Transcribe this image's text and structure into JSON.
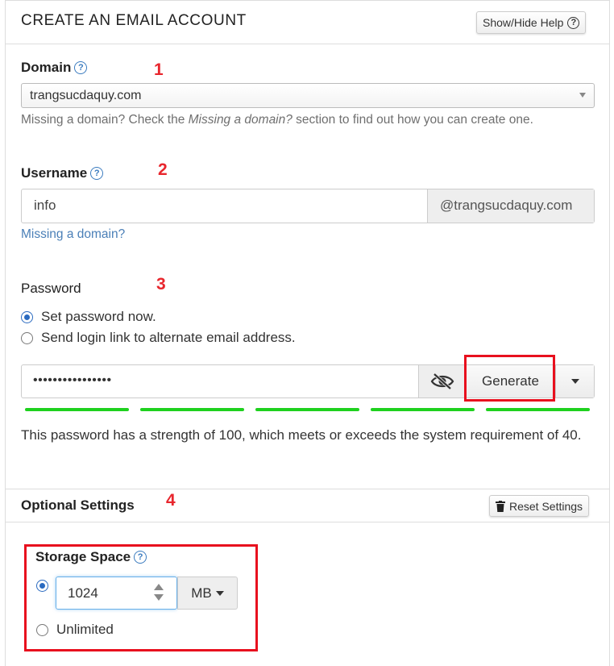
{
  "header": {
    "title": "CREATE AN EMAIL ACCOUNT",
    "help_button": "Show/Hide Help"
  },
  "domain": {
    "label": "Domain",
    "selected": "trangsucdaquy.com",
    "hint_pre": "Missing a domain? Check the ",
    "hint_em": "Missing a domain?",
    "hint_post": " section to find out how you can create one."
  },
  "username": {
    "label": "Username",
    "value": "info",
    "suffix": "@trangsucdaquy.com",
    "missing_link": "Missing a domain?"
  },
  "password": {
    "label": "Password",
    "option_now": "Set password now.",
    "option_link": "Send login link to alternate email address.",
    "value": "••••••••••••••••",
    "generate_label": "Generate",
    "strength_text": "This password has a strength of 100, which meets or exceeds the system requirement of 40.",
    "strength_segments": 5,
    "strength_color": "#1fd11f"
  },
  "optional": {
    "title": "Optional Settings",
    "reset_button": "Reset Settings"
  },
  "storage": {
    "label": "Storage Space",
    "value": "1024",
    "unit": "MB",
    "unlimited_label": "Unlimited"
  },
  "annotations": {
    "n1": "1",
    "n2": "2",
    "n3": "3",
    "n4": "4",
    "color": "#e8101e"
  }
}
